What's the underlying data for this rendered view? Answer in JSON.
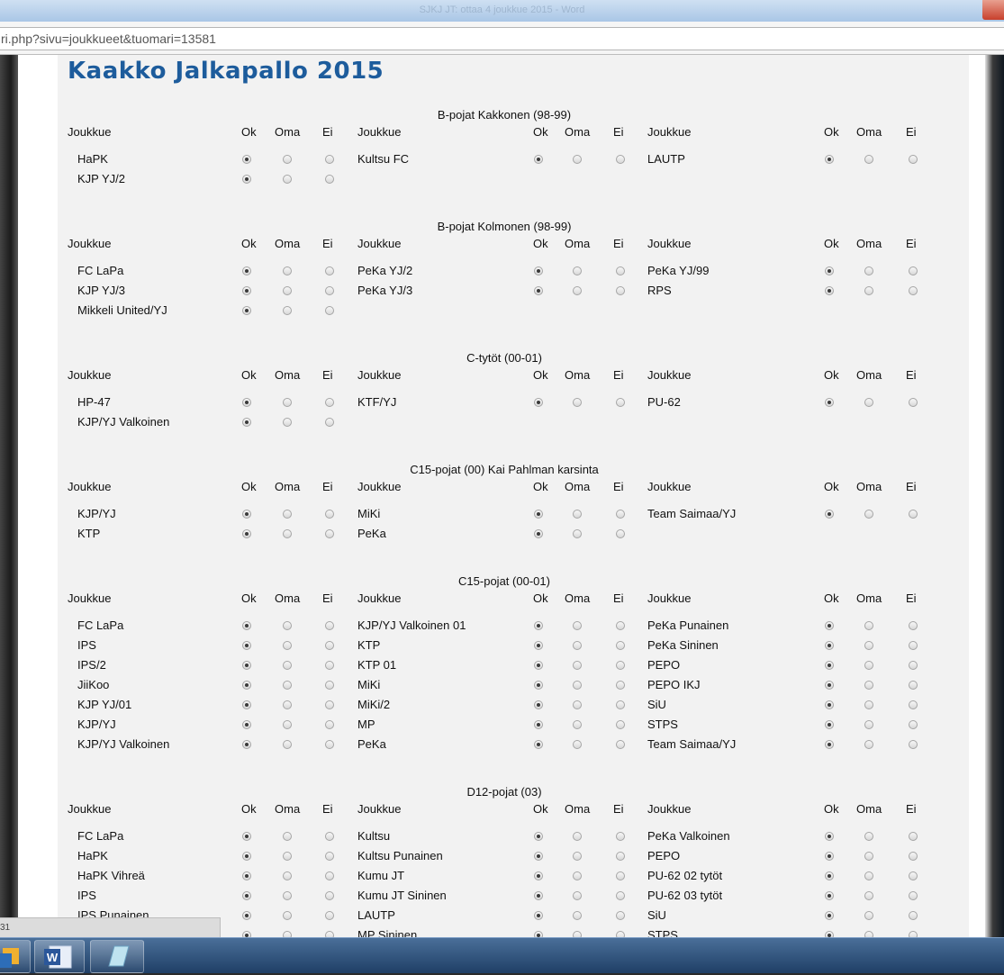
{
  "window": {
    "title": "SJKJ JT: ottaa 4 joukkue 2015 - Word"
  },
  "browser": {
    "url": "ri.php?sivu=joukkueet&tuomari=13581"
  },
  "site_title": "Kaakko Jalkapallo 2015",
  "headers": {
    "team": "Joukkue",
    "ok": "Ok",
    "oma": "Oma",
    "ei": "Ei"
  },
  "sections": [
    {
      "title": "B-pojat Kakkonen (98-99)",
      "columns": [
        [
          "HaPK",
          "KJP YJ/2"
        ],
        [
          "Kultsu FC"
        ],
        [
          "LAUTP"
        ]
      ]
    },
    {
      "title": "B-pojat Kolmonen (98-99)",
      "columns": [
        [
          "FC LaPa",
          "KJP YJ/3",
          "Mikkeli United/YJ"
        ],
        [
          "PeKa YJ/2",
          "PeKa YJ/3"
        ],
        [
          "PeKa YJ/99",
          "RPS"
        ]
      ]
    },
    {
      "title": "C-tytöt (00-01)",
      "columns": [
        [
          "HP-47",
          "KJP/YJ Valkoinen"
        ],
        [
          "KTF/YJ"
        ],
        [
          "PU-62"
        ]
      ]
    },
    {
      "title": "C15-pojat (00) Kai Pahlman karsinta",
      "columns": [
        [
          "KJP/YJ",
          "KTP"
        ],
        [
          "MiKi",
          "PeKa"
        ],
        [
          "Team Saimaa/YJ"
        ]
      ]
    },
    {
      "title": "C15-pojat (00-01)",
      "columns": [
        [
          "FC LaPa",
          "IPS",
          "IPS/2",
          "JiiKoo",
          "KJP YJ/01",
          "KJP/YJ",
          "KJP/YJ Valkoinen"
        ],
        [
          "KJP/YJ Valkoinen 01",
          "KTP",
          "KTP 01",
          "MiKi",
          "MiKi/2",
          "MP",
          "PeKa"
        ],
        [
          "PeKa Punainen",
          "PeKa Sininen",
          "PEPO",
          "PEPO IKJ",
          "SiU",
          "STPS",
          "Team Saimaa/YJ"
        ]
      ]
    },
    {
      "title": "D12-pojat (03)",
      "columns": [
        [
          "FC LaPa",
          "HaPK",
          "HaPK Vihreä",
          "IPS",
          "IPS Punainen",
          ""
        ],
        [
          "Kultsu",
          "Kultsu Punainen",
          "Kumu JT",
          "Kumu JT Sininen",
          "LAUTP",
          "MP Sininen"
        ],
        [
          "PeKa Valkoinen",
          "PEPO",
          "PU-62 02 tytöt",
          "PU-62 03 tytöt",
          "SiU",
          "STPS"
        ]
      ]
    }
  ],
  "taskbar": {
    "popup_text": "31",
    "buttons": [
      "outlook-app",
      "word-app",
      "notes-app"
    ]
  }
}
